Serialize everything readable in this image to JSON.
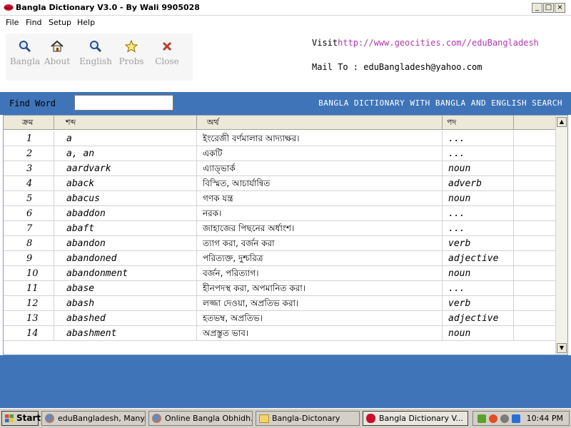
{
  "window": {
    "title": "Bangla Dictionary V3.0 - By Wali 9905028"
  },
  "menu": [
    "File",
    "Find",
    "Setup",
    "Help"
  ],
  "toolbar": {
    "buttons": [
      {
        "label": "Bangla",
        "icon": "magnifier-icon"
      },
      {
        "label": "About",
        "icon": "home-icon"
      },
      {
        "label": "English",
        "icon": "magnifier-icon"
      },
      {
        "label": "Probs",
        "icon": "star-icon"
      },
      {
        "label": "Close",
        "icon": "close-x-icon"
      }
    ]
  },
  "info": {
    "visit_label": "Visit",
    "visit_url": "http://www.geocities.com//eduBangladesh",
    "mail_label": "Mail To : ",
    "mail_value": "eduBangladesh@yahoo.com"
  },
  "find": {
    "label": "Find Word",
    "value": "",
    "banner": "BANGLA DICTIONARY WITH BANGLA AND ENGLISH SEARCH"
  },
  "table": {
    "headers": [
      "ক্রম",
      "শব্দ",
      "অর্থ",
      "পদ",
      ""
    ],
    "rows": [
      {
        "num": "1",
        "word": "a",
        "meaning": "ইংরেজী বর্ণমালার আদ্যাক্ষর।",
        "pos": "..."
      },
      {
        "num": "2",
        "word": "a, an",
        "meaning": "একটি",
        "pos": "..."
      },
      {
        "num": "3",
        "word": "aardvark",
        "meaning": "এ্যাড্ভার্ক",
        "pos": "noun"
      },
      {
        "num": "4",
        "word": "aback",
        "meaning": "বিস্মিত, আচার্যান্বিত",
        "pos": "adverb"
      },
      {
        "num": "5",
        "word": "abacus",
        "meaning": "গণক যন্ত্র",
        "pos": "noun"
      },
      {
        "num": "6",
        "word": "abaddon",
        "meaning": "নরক।",
        "pos": "..."
      },
      {
        "num": "7",
        "word": "abaft",
        "meaning": "জাহাজের পিছনের অর্ধাংশ।",
        "pos": "..."
      },
      {
        "num": "8",
        "word": "abandon",
        "meaning": "ত্যাগ করা, বর্জন করা",
        "pos": "verb"
      },
      {
        "num": "9",
        "word": "abandoned",
        "meaning": "পরিত্যক্ত, দুশ্চরিত্র",
        "pos": "adjective"
      },
      {
        "num": "10",
        "word": "abandonment",
        "meaning": "বর্জন, পরিত্যাগ।",
        "pos": "noun"
      },
      {
        "num": "11",
        "word": "abase",
        "meaning": "হীনপদস্থ করা, অপমানিত করা।",
        "pos": "..."
      },
      {
        "num": "12",
        "word": "abash",
        "meaning": "লজ্জা দেওয়া, অপ্রতিভ করা।",
        "pos": "verb"
      },
      {
        "num": "13",
        "word": "abashed",
        "meaning": "হতভম্ব, অপ্রতিভ।",
        "pos": "adjective"
      },
      {
        "num": "14",
        "word": "abashment",
        "meaning": "অপ্রস্তুত ভাব।",
        "pos": "noun"
      }
    ]
  },
  "taskbar": {
    "start": "Start",
    "tasks": [
      {
        "label": "eduBangladesh, Many...",
        "icon": "firefox-icon",
        "active": false
      },
      {
        "label": "Online Bangla Obhidh...",
        "icon": "firefox-icon",
        "active": false
      },
      {
        "label": "Bangla-Dictonary",
        "icon": "folder-icon",
        "active": false
      },
      {
        "label": "Bangla Dictionary V...",
        "icon": "app-icon",
        "active": true
      }
    ],
    "clock": "10:44 PM"
  },
  "colors": {
    "accent": "#3f74b8",
    "link": "#b03ab0",
    "toolbar_label": "#a0a0a0"
  }
}
